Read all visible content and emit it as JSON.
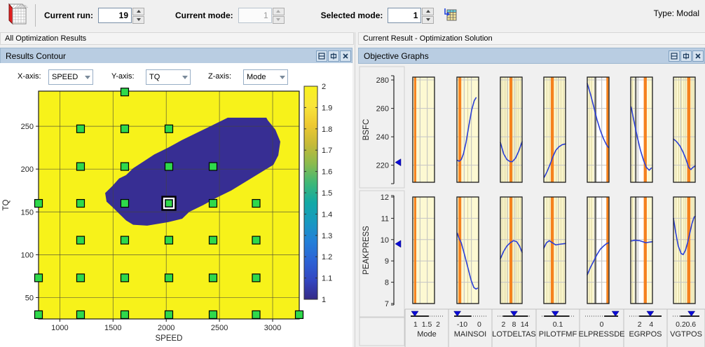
{
  "toolbar": {
    "current_run": {
      "label": "Current run:",
      "value": "19"
    },
    "current_mode": {
      "label": "Current mode:",
      "value": "1"
    },
    "selected_mode": {
      "label": "Selected mode:",
      "value": "1"
    },
    "type_label": "Type: Modal"
  },
  "left_panel": {
    "header": "All Optimization Results",
    "title": "Results Contour",
    "controls": {
      "x_axis": {
        "label": "X-axis:",
        "value": "SPEED"
      },
      "y_axis": {
        "label": "Y-axis:",
        "value": "TQ"
      },
      "z_axis": {
        "label": "Z-axis:",
        "value": "Mode"
      }
    }
  },
  "right_panel": {
    "header": "Current Result - Optimization Solution",
    "title": "Objective Graphs"
  },
  "chart_data": [
    {
      "type": "heatmap",
      "xlabel": "SPEED",
      "ylabel": "TQ",
      "xlim": [
        800,
        3250
      ],
      "ylim": [
        25,
        291
      ],
      "xticks": [
        1000,
        1500,
        2000,
        2500,
        3000
      ],
      "yticks": [
        50,
        100,
        150,
        200,
        250
      ],
      "background_value": 2,
      "region_value": 1,
      "region_outline": [
        [
          1426,
          172
        ],
        [
          1492,
          180
        ],
        [
          1557,
          189
        ],
        [
          1623,
          193
        ],
        [
          1689,
          201
        ],
        [
          1788,
          209
        ],
        [
          1887,
          217
        ],
        [
          2018,
          225
        ],
        [
          2150,
          234
        ],
        [
          2282,
          242
        ],
        [
          2414,
          250
        ],
        [
          2545,
          258
        ],
        [
          2578,
          260
        ],
        [
          2941,
          260
        ],
        [
          2954,
          257
        ],
        [
          3026,
          246
        ],
        [
          3072,
          232
        ],
        [
          3053,
          216
        ],
        [
          3007,
          205
        ],
        [
          2611,
          175
        ],
        [
          2480,
          167
        ],
        [
          2348,
          158
        ],
        [
          2216,
          150
        ],
        [
          2150,
          142
        ],
        [
          2018,
          138
        ],
        [
          1821,
          134
        ],
        [
          1689,
          135
        ],
        [
          1623,
          140
        ],
        [
          1557,
          148
        ],
        [
          1492,
          156
        ],
        [
          1439,
          162
        ]
      ],
      "markers": [
        [
          1610,
          290
        ],
        [
          1195,
          247
        ],
        [
          1610,
          247
        ],
        [
          2025,
          247
        ],
        [
          1195,
          203
        ],
        [
          1610,
          203
        ],
        [
          2025,
          203
        ],
        [
          2440,
          203
        ],
        [
          800,
          160
        ],
        [
          1195,
          160
        ],
        [
          1610,
          160
        ],
        [
          2440,
          160
        ],
        [
          2845,
          160
        ],
        [
          1195,
          117
        ],
        [
          1610,
          117
        ],
        [
          2025,
          117
        ],
        [
          2440,
          117
        ],
        [
          2845,
          117
        ],
        [
          800,
          73
        ],
        [
          1195,
          73
        ],
        [
          1610,
          73
        ],
        [
          2025,
          73
        ],
        [
          2440,
          73
        ],
        [
          2845,
          73
        ],
        [
          800,
          30
        ],
        [
          1195,
          30
        ],
        [
          1610,
          30
        ],
        [
          2025,
          30
        ],
        [
          2440,
          30
        ],
        [
          2845,
          30
        ],
        [
          3250,
          30
        ]
      ],
      "selected_marker": [
        2025,
        160
      ],
      "colorbar": {
        "min": 1,
        "max": 2,
        "ticks": [
          "2",
          "1.9",
          "1.8",
          "1.7",
          "1.6",
          "1.5",
          "1.4",
          "1.3",
          "1.2",
          "1.1",
          "1"
        ],
        "tick_values": [
          2,
          1.9,
          1.8,
          1.7,
          1.6,
          1.5,
          1.4,
          1.3,
          1.2,
          1.1,
          1
        ],
        "gradient": [
          "#352a87",
          "#3347c2",
          "#2c63d5",
          "#2380d8",
          "#1899c0",
          "#12a9a5",
          "#3fb877",
          "#8bbb4e",
          "#c6ba38",
          "#eec932",
          "#f9e53a",
          "#f9f21d"
        ]
      },
      "colors": {
        "high": "#f7f21a",
        "low": "#372e93",
        "marker": "#2fd94b",
        "grid": "#44443a"
      }
    },
    {
      "type": "line",
      "title": "Objective Graphs",
      "rows": [
        {
          "label": "BSFC",
          "ylim": [
            208,
            282
          ],
          "yticks": [
            "220",
            "240",
            "260",
            "280"
          ],
          "ytick_values": [
            220,
            240,
            260,
            280
          ],
          "indicator": 222
        },
        {
          "label": "PEAKPRESS",
          "ylim": [
            7,
            12
          ],
          "yticks": [
            "7",
            "8",
            "9",
            "10",
            "11",
            "12"
          ],
          "ytick_values": [
            7,
            8,
            9,
            10,
            11,
            12
          ],
          "indicator": 9.8
        }
      ],
      "columns": [
        {
          "label": "Mode",
          "axis_ticks": [
            {
              "t": "1",
              "x": 0.15
            },
            {
              "t": "1.5",
              "x": 0.5
            },
            {
              "t": "2",
              "x": 0.85
            }
          ],
          "slider": 0.13,
          "orange": [
            0.06,
            0.16
          ],
          "gray": null,
          "white": null,
          "minor": [],
          "curves": [
            null,
            null
          ]
        },
        {
          "label": "MAINSOI",
          "axis_ticks": [
            {
              "t": "-10",
              "x": 0.25
            },
            {
              "t": "0",
              "x": 0.78
            }
          ],
          "slider": 0.1,
          "orange": [
            0.07,
            0.2
          ],
          "gray": null,
          "white": null,
          "minor": [
            0.5
          ],
          "curves": [
            [
              [
                0.02,
                223.5
              ],
              [
                0.1,
                222.8
              ],
              [
                0.2,
                224
              ],
              [
                0.3,
                228
              ],
              [
                0.42,
                236
              ],
              [
                0.55,
                248
              ],
              [
                0.68,
                259
              ],
              [
                0.8,
                265.5
              ],
              [
                0.88,
                267.5
              ]
            ],
            [
              [
                0.02,
                10.3
              ],
              [
                0.08,
                10.1
              ],
              [
                0.2,
                9.85
              ],
              [
                0.35,
                9.3
              ],
              [
                0.5,
                8.7
              ],
              [
                0.65,
                8.1
              ],
              [
                0.78,
                7.75
              ],
              [
                0.88,
                7.68
              ],
              [
                0.95,
                7.72
              ]
            ]
          ]
        },
        {
          "label": "LOTDELTAS",
          "axis_ticks": [
            {
              "t": "2",
              "x": 0.18
            },
            {
              "t": "8",
              "x": 0.5
            },
            {
              "t": "14",
              "x": 0.82
            }
          ],
          "slider": 0.5,
          "orange": [
            0.42,
            0.55
          ],
          "gray": null,
          "white": null,
          "minor": [
            0.08,
            0.17,
            0.25,
            0.33,
            0.58,
            0.67,
            0.75,
            0.83,
            0.92
          ],
          "curves": [
            [
              [
                0,
                236
              ],
              [
                0.15,
                228
              ],
              [
                0.3,
                224
              ],
              [
                0.45,
                222.5
              ],
              [
                0.55,
                222.5
              ],
              [
                0.7,
                225
              ],
              [
                0.85,
                230
              ],
              [
                1,
                236.5
              ]
            ],
            [
              [
                0,
                9.1
              ],
              [
                0.15,
                9.45
              ],
              [
                0.3,
                9.7
              ],
              [
                0.45,
                9.85
              ],
              [
                0.6,
                9.95
              ],
              [
                0.75,
                9.9
              ],
              [
                0.88,
                9.7
              ],
              [
                1,
                9.4
              ]
            ]
          ]
        },
        {
          "label": "PILOTFMF",
          "axis_ticks": [
            {
              "t": "0.1",
              "x": 0.5
            }
          ],
          "slider": 0.42,
          "orange": [
            0.32,
            0.46
          ],
          "gray": null,
          "white": null,
          "minor": [
            0.14,
            0.25,
            0.57,
            0.68,
            0.79,
            0.9
          ],
          "curves": [
            [
              [
                0.02,
                211.5
              ],
              [
                0.15,
                215.5
              ],
              [
                0.3,
                221
              ],
              [
                0.42,
                226
              ],
              [
                0.55,
                230.5
              ],
              [
                0.7,
                233
              ],
              [
                0.85,
                234.5
              ],
              [
                1,
                235
              ]
            ],
            [
              [
                0,
                9.6
              ],
              [
                0.12,
                9.85
              ],
              [
                0.25,
                9.95
              ],
              [
                0.4,
                9.85
              ],
              [
                0.55,
                9.75
              ],
              [
                0.7,
                9.78
              ],
              [
                0.85,
                9.8
              ],
              [
                1,
                9.82
              ]
            ]
          ]
        },
        {
          "label": "ELPRESSDE",
          "axis_ticks": [
            {
              "t": "0",
              "x": 0.5
            }
          ],
          "slider": 0.92,
          "orange": [
            0.88,
            0.98
          ],
          "gray": [
            0.34,
            0.42
          ],
          "white": [
            0.31,
            1
          ],
          "minor": [
            0.1,
            0.2
          ],
          "curves": [
            [
              [
                0,
                277.5
              ],
              [
                0.15,
                270
              ],
              [
                0.3,
                261
              ],
              [
                0.45,
                252
              ],
              [
                0.6,
                244.5
              ],
              [
                0.75,
                238.5
              ],
              [
                0.88,
                234.5
              ],
              [
                0.97,
                232.5
              ]
            ],
            [
              [
                0,
                8.35
              ],
              [
                0.15,
                8.7
              ],
              [
                0.3,
                9.0
              ],
              [
                0.45,
                9.3
              ],
              [
                0.6,
                9.55
              ],
              [
                0.75,
                9.7
              ],
              [
                0.9,
                9.82
              ],
              [
                0.98,
                9.85
              ]
            ]
          ]
        },
        {
          "label": "EGRPOS",
          "axis_ticks": [
            {
              "t": "2",
              "x": 0.32
            },
            {
              "t": "4",
              "x": 0.68
            }
          ],
          "slider": 0.65,
          "orange": [
            0.6,
            0.74
          ],
          "gray": [
            0.19,
            0.27
          ],
          "white": [
            0.17,
            0.76
          ],
          "minor": [
            0.08
          ],
          "curves": [
            [
              [
                0.02,
                261
              ],
              [
                0.15,
                251
              ],
              [
                0.3,
                240
              ],
              [
                0.45,
                230.5
              ],
              [
                0.6,
                223
              ],
              [
                0.72,
                218.5
              ],
              [
                0.85,
                216.5
              ],
              [
                0.95,
                218
              ]
            ],
            [
              [
                0,
                9.93
              ],
              [
                0.2,
                9.97
              ],
              [
                0.4,
                9.95
              ],
              [
                0.55,
                9.9
              ],
              [
                0.7,
                9.85
              ],
              [
                0.85,
                9.88
              ],
              [
                1,
                9.9
              ]
            ]
          ]
        },
        {
          "label": "VGTPOS",
          "axis_ticks": [
            {
              "t": "0.2",
              "x": 0.3
            },
            {
              "t": "0.6",
              "x": 0.68
            }
          ],
          "slider": 0.7,
          "orange": [
            0.63,
            0.78
          ],
          "gray": null,
          "white": null,
          "minor": [
            0.12,
            0.24,
            0.36,
            0.48,
            0.56,
            0.85,
            0.93
          ],
          "curves": [
            [
              [
                0,
                238.5
              ],
              [
                0.15,
                236.5
              ],
              [
                0.3,
                233.5
              ],
              [
                0.45,
                229
              ],
              [
                0.58,
                224
              ],
              [
                0.7,
                218.5
              ],
              [
                0.8,
                217
              ],
              [
                0.9,
                218.5
              ],
              [
                1,
                219.5
              ]
            ],
            [
              [
                0,
                11.0
              ],
              [
                0.1,
                10.35
              ],
              [
                0.22,
                9.7
              ],
              [
                0.35,
                9.35
              ],
              [
                0.45,
                9.3
              ],
              [
                0.55,
                9.5
              ],
              [
                0.65,
                9.85
              ],
              [
                0.75,
                10.3
              ],
              [
                0.85,
                10.75
              ],
              [
                0.95,
                11.05
              ],
              [
                1,
                11.1
              ]
            ]
          ]
        }
      ],
      "colors": {
        "plot_bg": "#fdf9d2",
        "orange_band": "#f5821e",
        "gray_band": "#6f6f68",
        "curve": "#2b3fd6",
        "indicator": "#0b0bd6"
      }
    }
  ]
}
